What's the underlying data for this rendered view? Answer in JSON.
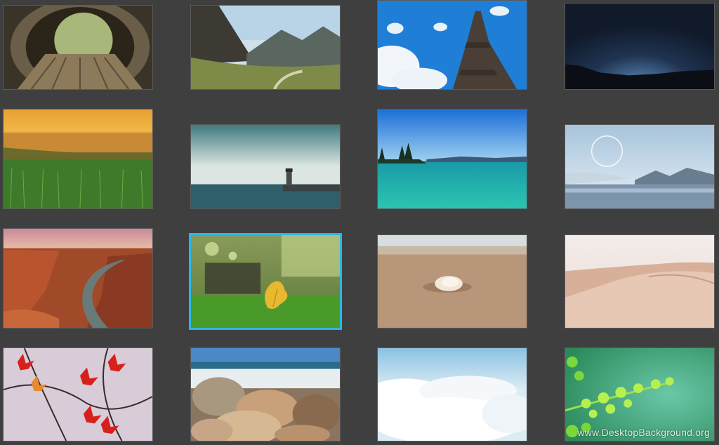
{
  "gallery": {
    "selected_index": 9,
    "thumbnails": [
      {
        "id": "wooden-tunnel"
      },
      {
        "id": "mountain-valley"
      },
      {
        "id": "eiffel-tower"
      },
      {
        "id": "night-sky"
      },
      {
        "id": "sunset-field"
      },
      {
        "id": "lighthouse-sea"
      },
      {
        "id": "turquoise-lake"
      },
      {
        "id": "moon-mountains"
      },
      {
        "id": "canyon-river"
      },
      {
        "id": "yellow-leaf-grass"
      },
      {
        "id": "seashell-beach"
      },
      {
        "id": "sand-dunes"
      },
      {
        "id": "red-maple-leaves"
      },
      {
        "id": "rocky-shore"
      },
      {
        "id": "clouds"
      },
      {
        "id": "green-fern"
      }
    ]
  },
  "watermark": {
    "text": "www.DesktopBackground.org"
  }
}
